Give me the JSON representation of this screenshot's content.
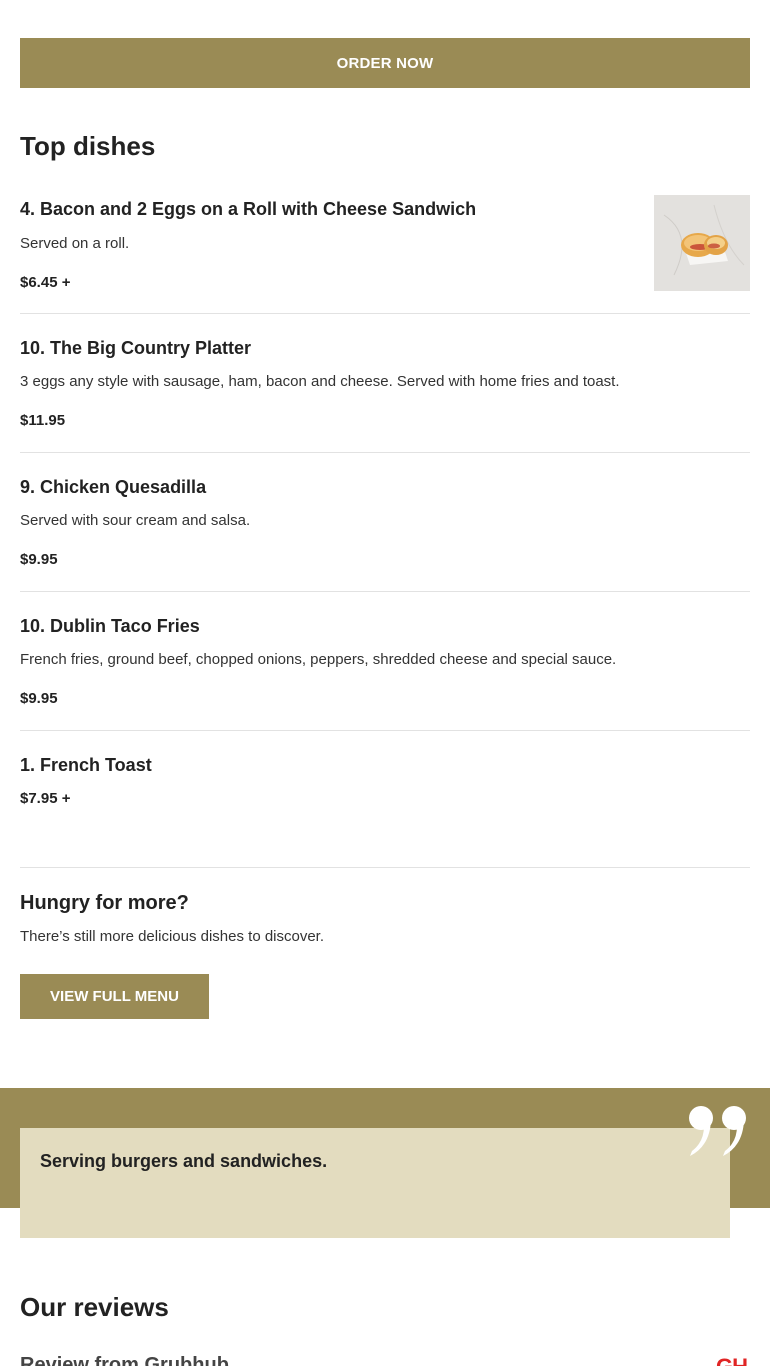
{
  "order_button": {
    "label": "ORDER NOW"
  },
  "top_dishes": {
    "title": "Top dishes",
    "items": [
      {
        "name": "4. Bacon and 2 Eggs on a Roll with Cheese Sandwich",
        "description": "Served on a roll.",
        "price": "$6.45 +",
        "has_image": true
      },
      {
        "name": "10. The Big Country Platter",
        "description": "3 eggs any style with sausage, ham, bacon and cheese. Served with home fries and toast.",
        "price": "$11.95"
      },
      {
        "name": "9. Chicken Quesadilla",
        "description": "Served with sour cream and salsa.",
        "price": "$9.95"
      },
      {
        "name": "10. Dublin Taco Fries",
        "description": "French fries, ground beef, chopped onions, peppers, shredded cheese and special sauce.",
        "price": "$9.95"
      },
      {
        "name": "1. French Toast",
        "price": "$7.95 +"
      }
    ]
  },
  "hungry": {
    "title": "Hungry for more?",
    "subtitle": "There’s still more delicious dishes to discover.",
    "button_label": "VIEW FULL MENU"
  },
  "quote": {
    "text": "Serving burgers and sandwiches.",
    "icon": "quote-mark-icon"
  },
  "reviews": {
    "title": "Our reviews",
    "first_author": "Review from Grubhub",
    "source_logo": "GH",
    "source_logo_color": "#e02424"
  },
  "colors": {
    "accent": "#9a8b55",
    "quote_bg": "#e3dcbf",
    "divider": "#e2e2e2"
  }
}
